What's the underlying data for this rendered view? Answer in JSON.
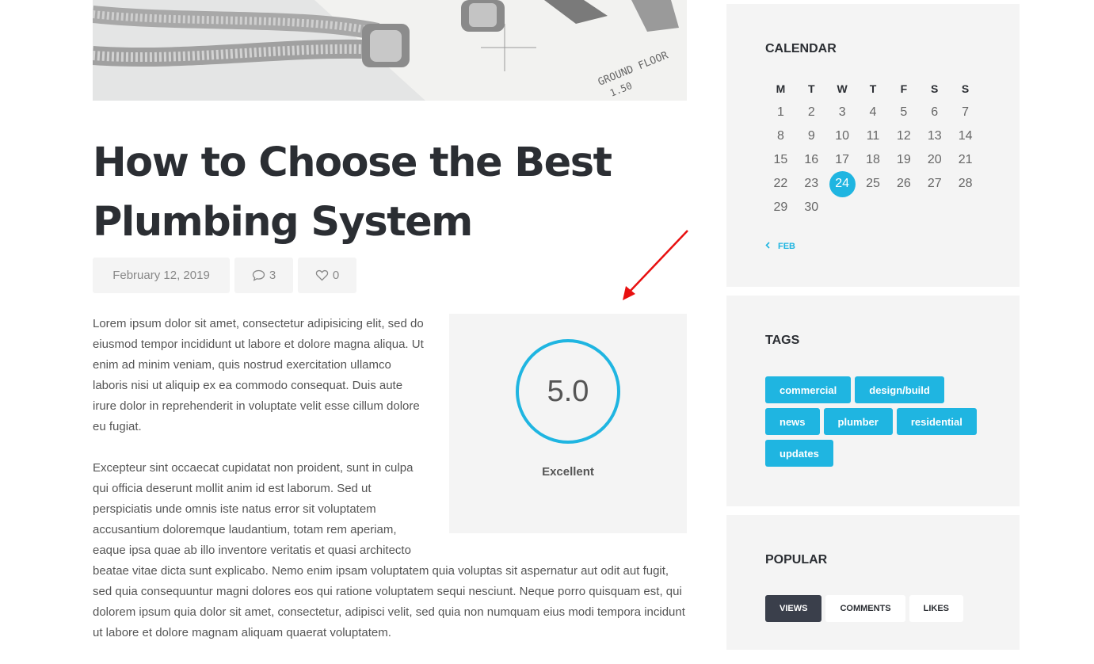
{
  "post": {
    "title": "How to Choose the Best Plumbing System",
    "date": "February 12, 2019",
    "comments_count": "3",
    "likes_count": "0",
    "paragraphs": [
      "Lorem ipsum dolor sit amet, consectetur adipisicing elit, sed do eiusmod tempor incididunt ut labore et dolore magna aliqua. Ut enim ad minim veniam, quis nostrud exercitation ullamco laboris nisi ut aliquip ex ea commodo consequat. Duis aute irure dolor in reprehenderit in voluptate velit esse cillum dolore eu fugiat.",
      "Excepteur sint occaecat cupidatat non proident, sunt in culpa qui officia deserunt mollit anim id est laborum. Sed ut perspiciatis unde omnis iste natus error sit voluptatem accusantium doloremque laudantium, totam rem aperiam, eaque ipsa quae ab illo inventore veritatis et quasi architecto beatae vitae dicta sunt explicabo. Nemo enim ipsam voluptatem quia voluptas sit aspernatur aut odit aut fugit, sed quia consequuntur magni dolores eos qui ratione voluptatem sequi nesciunt. Neque porro quisquam est, qui dolorem ipsum quia dolor sit amet, consectetur, adipisci velit, sed quia non numquam eius modi tempora incidunt ut labore et dolore magnam aliquam quaerat voluptatem."
    ],
    "rating": {
      "score": "5.0",
      "label": "Excellent"
    },
    "hero_image": {
      "blueprint_text_1": "GROUND FLOOR",
      "blueprint_text_2": "1.50"
    }
  },
  "sidebar": {
    "calendar": {
      "title": "CALENDAR",
      "weekdays": [
        "M",
        "T",
        "W",
        "T",
        "F",
        "S",
        "S"
      ],
      "weeks": [
        [
          "1",
          "2",
          "3",
          "4",
          "5",
          "6",
          "7"
        ],
        [
          "8",
          "9",
          "10",
          "11",
          "12",
          "13",
          "14"
        ],
        [
          "15",
          "16",
          "17",
          "18",
          "19",
          "20",
          "21"
        ],
        [
          "22",
          "23",
          "24",
          "25",
          "26",
          "27",
          "28"
        ],
        [
          "29",
          "30",
          "",
          "",
          "",
          "",
          ""
        ]
      ],
      "today": "24",
      "prev_label": "FEB"
    },
    "tags": {
      "title": "TAGS",
      "items": [
        "commercial",
        "design/build",
        "news",
        "plumber",
        "residential",
        "updates"
      ]
    },
    "popular": {
      "title": "POPULAR",
      "tabs": [
        "VIEWS",
        "COMMENTS",
        "LIKES"
      ],
      "active_tab": "VIEWS"
    }
  },
  "colors": {
    "accent": "#1fb5e1",
    "dark": "#2b2e33",
    "annotation_arrow": "#e81010"
  },
  "icons": {
    "comments": "speech-bubble-icon",
    "likes": "heart-icon",
    "prev": "chevron-left-icon"
  }
}
